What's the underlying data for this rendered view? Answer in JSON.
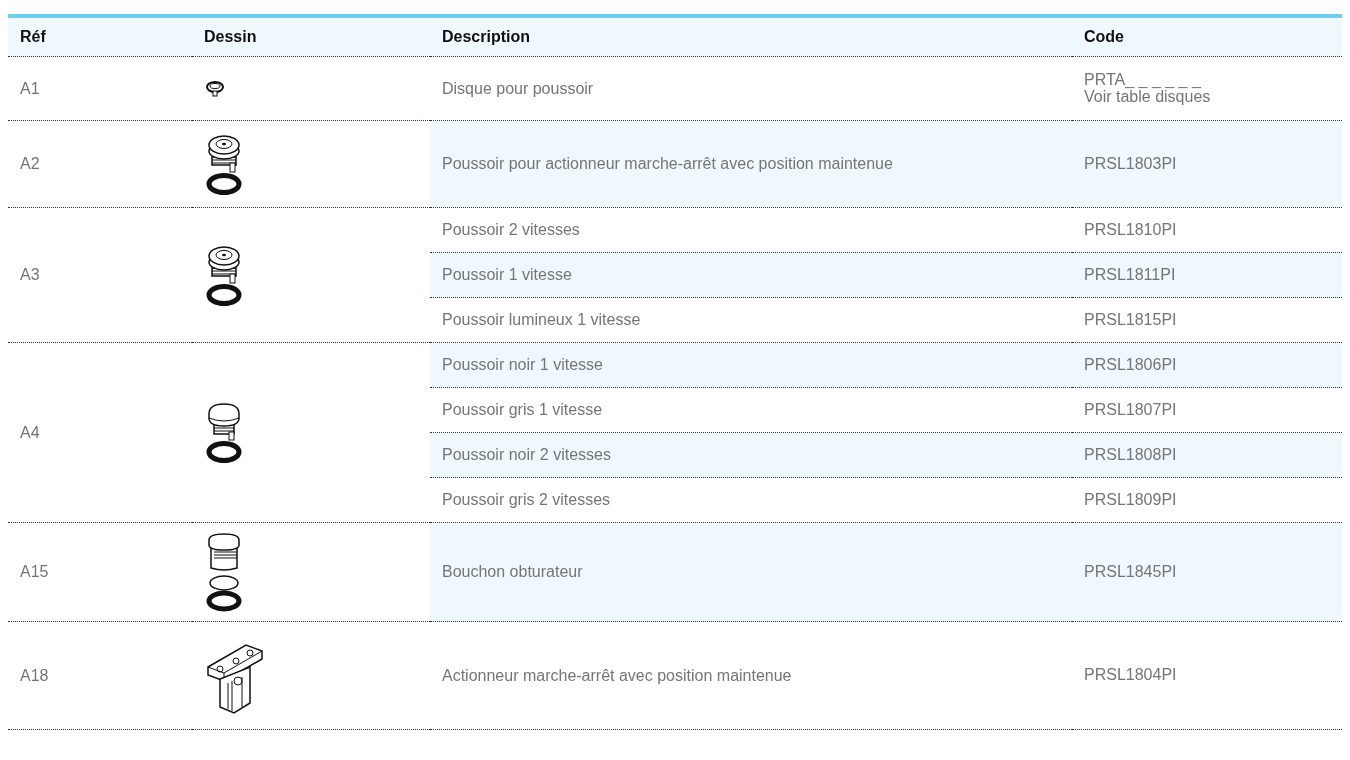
{
  "table": {
    "columns": [
      "Réf",
      "Dessin",
      "Description",
      "Code"
    ],
    "groups": [
      {
        "ref": "A1",
        "kind": "disc",
        "items": [
          {
            "description": "Disque pour poussoir",
            "code": "PRTA_ _ _ _ _ _",
            "note": "Voir table disques"
          }
        ]
      },
      {
        "ref": "A2",
        "kind": "pushbutton",
        "items": [
          {
            "description": "Poussoir pour actionneur marche-arrêt avec position maintenue",
            "code": "PRSL1803PI"
          }
        ]
      },
      {
        "ref": "A3",
        "kind": "pushbutton",
        "items": [
          {
            "description": "Poussoir 2 vitesses",
            "code": "PRSL1810PI"
          },
          {
            "description": "Poussoir 1 vitesse",
            "code": "PRSL1811PI"
          },
          {
            "description": "Poussoir lumineux 1 vitesse",
            "code": "PRSL1815PI"
          }
        ]
      },
      {
        "ref": "A4",
        "kind": "mushroom",
        "items": [
          {
            "description": "Poussoir noir 1 vitesse",
            "code": "PRSL1806PI"
          },
          {
            "description": "Poussoir gris 1 vitesse",
            "code": "PRSL1807PI"
          },
          {
            "description": "Poussoir noir 2 vitesses",
            "code": "PRSL1808PI"
          },
          {
            "description": "Poussoir gris 2 vitesses",
            "code": "PRSL1809PI"
          }
        ]
      },
      {
        "ref": "A15",
        "kind": "plug",
        "items": [
          {
            "description": "Bouchon obturateur",
            "code": "PRSL1845PI"
          }
        ]
      },
      {
        "ref": "A18",
        "kind": "actuator",
        "items": [
          {
            "description": "Actionneur marche-arrêt avec position maintenue",
            "code": "PRSL1804PI"
          }
        ]
      }
    ]
  }
}
